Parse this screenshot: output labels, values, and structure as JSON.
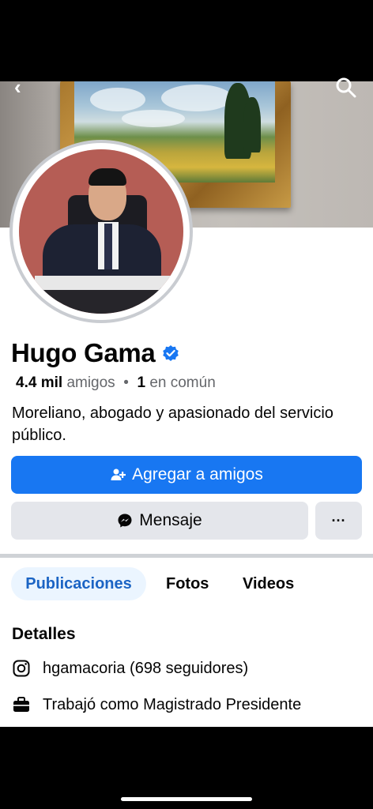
{
  "profile": {
    "name": "Hugo Gama",
    "friends_count": "4.4 mil",
    "friends_label": "amigos",
    "separator": "•",
    "mutual_count": "1",
    "mutual_label": "en común",
    "bio": "Moreliano, abogado y apasionado del servicio público."
  },
  "actions": {
    "add_friend": "Agregar a amigos",
    "message": "Mensaje",
    "more": "···"
  },
  "tabs": [
    {
      "label": "Publicaciones",
      "active": true
    },
    {
      "label": "Fotos",
      "active": false
    },
    {
      "label": "Videos",
      "active": false
    }
  ],
  "details": {
    "title": "Detalles",
    "instagram": "hgamacoria (698 seguidores)",
    "work": "Trabajó como Magistrado Presidente"
  },
  "nav": {
    "back_icon": "chevron-left-icon",
    "search_icon": "search-icon"
  },
  "colors": {
    "primary": "#1877f2",
    "secondary_button": "#e4e6eb",
    "active_tab_bg": "#ebf5ff",
    "active_tab_text": "#1b64c4"
  }
}
